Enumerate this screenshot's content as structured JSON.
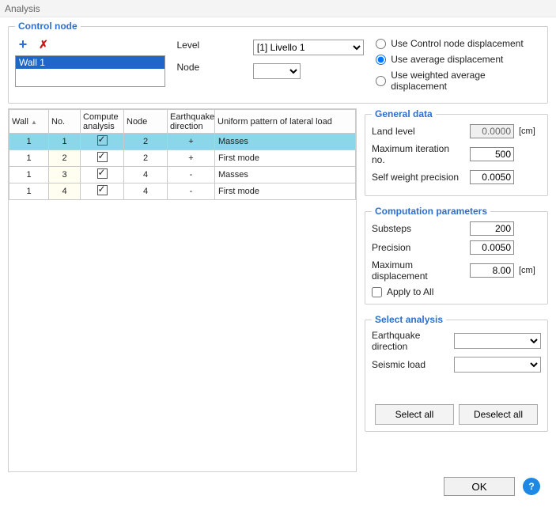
{
  "title": "Analysis",
  "control_node": {
    "legend": "Control node",
    "wall_selected": "Wall 1",
    "labels": {
      "level": "Level",
      "node": "Node"
    },
    "level_options": [
      "[1]  Livello 1"
    ],
    "level_value": "[1]  Livello 1",
    "node_value": ""
  },
  "disp": {
    "opt1": "Use Control node displacement",
    "opt2": "Use average displacement",
    "opt3": "Use weighted average displacement",
    "selected": 2
  },
  "table": {
    "headers": {
      "wall": "Wall",
      "no": "No.",
      "compute": "Compute analysis",
      "node": "Node",
      "eq": "Earthquake direction",
      "pattern": "Uniform pattern of lateral load"
    },
    "rows": [
      {
        "wall": "1",
        "no": "1",
        "compute": true,
        "node": "2",
        "eq": "+",
        "pattern": "Masses",
        "selected": true
      },
      {
        "wall": "1",
        "no": "2",
        "compute": true,
        "node": "2",
        "eq": "+",
        "pattern": "First mode"
      },
      {
        "wall": "1",
        "no": "3",
        "compute": true,
        "node": "4",
        "eq": "-",
        "pattern": "Masses"
      },
      {
        "wall": "1",
        "no": "4",
        "compute": true,
        "node": "4",
        "eq": "-",
        "pattern": "First mode"
      }
    ]
  },
  "general_data": {
    "legend": "General data",
    "land_level_label": "Land level",
    "land_level": "0.0000",
    "land_level_unit": "[cm]",
    "max_iter_label": "Maximum iteration no.",
    "max_iter": "500",
    "self_weight_label": "Self weight precision",
    "self_weight": "0.0050"
  },
  "comp_params": {
    "legend": "Computation parameters",
    "substeps_label": "Substeps",
    "substeps": "200",
    "precision_label": "Precision",
    "precision": "0.0050",
    "max_disp_label": "Maximum displacement",
    "max_disp": "8.00",
    "max_disp_unit": "[cm]",
    "apply_all_label": "Apply to All"
  },
  "select_analysis": {
    "legend": "Select analysis",
    "eq_dir_label": "Earthquake direction",
    "seismic_load_label": "Seismic load",
    "select_all": "Select all",
    "deselect_all": "Deselect all"
  },
  "bottom": {
    "ok": "OK"
  }
}
